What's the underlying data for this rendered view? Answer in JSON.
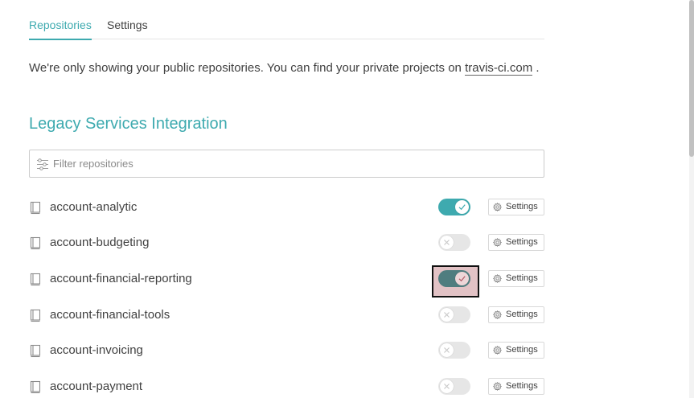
{
  "tabs": [
    {
      "label": "Repositories",
      "active": true
    },
    {
      "label": "Settings",
      "active": false
    }
  ],
  "notice": {
    "text": "We're only showing your public repositories. You can find your private projects on",
    "link_text": "travis-ci.com",
    "suffix": "."
  },
  "section_title": "Legacy Services Integration",
  "filter": {
    "placeholder": "Filter repositories",
    "value": ""
  },
  "repos": [
    {
      "name": "account-analytic",
      "enabled": true,
      "settings_label": "Settings"
    },
    {
      "name": "account-budgeting",
      "enabled": false,
      "settings_label": "Settings"
    },
    {
      "name": "account-financial-reporting",
      "enabled": true,
      "settings_label": "Settings"
    },
    {
      "name": "account-financial-tools",
      "enabled": false,
      "settings_label": "Settings"
    },
    {
      "name": "account-invoicing",
      "enabled": false,
      "settings_label": "Settings"
    },
    {
      "name": "account-payment",
      "enabled": false,
      "settings_label": "Settings"
    }
  ],
  "colors": {
    "accent": "#3eaaaf",
    "toggle_off": "#e6e6e6",
    "text": "#404040"
  },
  "icons": {
    "repo": "repo-book-icon",
    "filter": "filter-sliders-icon",
    "settings": "gear-icon",
    "check": "check-icon",
    "cross": "x-icon"
  }
}
